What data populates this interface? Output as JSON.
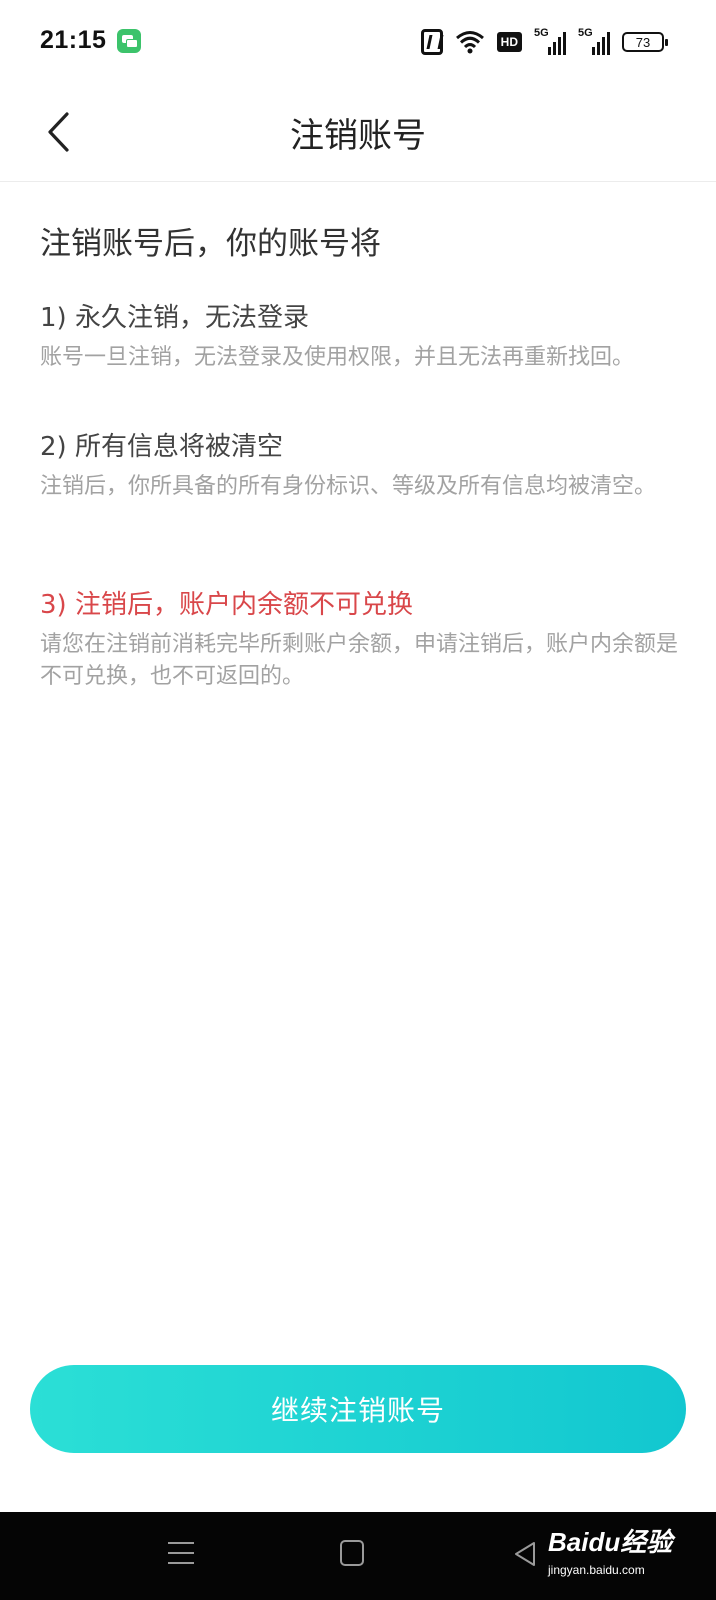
{
  "status_bar": {
    "time": "21:15",
    "hd_label": "HD",
    "signal_label": "5G",
    "battery": "73"
  },
  "header": {
    "title": "注销账号"
  },
  "content": {
    "intro": "注销账号后，你的账号将",
    "items": [
      {
        "title": "1) 永久注销，无法登录",
        "desc": "账号一旦注销，无法登录及使用权限，并且无法再重新找回。"
      },
      {
        "title": "2) 所有信息将被清空",
        "desc": "注销后，你所具备的所有身份标识、等级及所有信息均被清空。"
      },
      {
        "title": "3) 注销后，账户内余额不可兑换",
        "desc": "请您在注销前消耗完毕所剩账户余额，申请注销后，账户内余额是不可兑换，也不可返回的。"
      }
    ]
  },
  "button": {
    "label": "继续注销账号"
  },
  "watermark": {
    "brand": "Baidu经验",
    "url": "jingyan.baidu.com"
  },
  "colors": {
    "accent": "#14cdd0",
    "warning": "#d9474a"
  }
}
